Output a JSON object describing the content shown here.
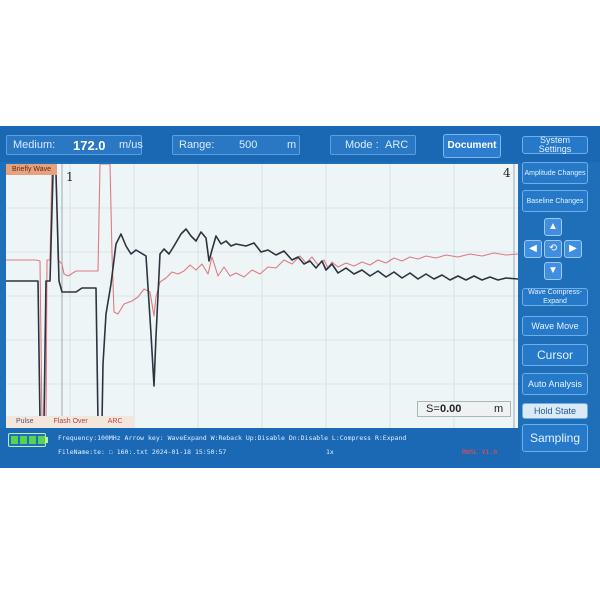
{
  "header": {
    "medium_label": "Medium:",
    "medium_value": "172.0",
    "medium_unit": "m/us",
    "range_label": "Range:",
    "range_value": "500",
    "range_unit": "m",
    "mode_label": "Mode :",
    "mode_value": "ARC",
    "document_button": "Document"
  },
  "sidebar": {
    "system_settings": "System Settings",
    "amplitude_changes": "Amplitude Changes",
    "baseline_changes": "Baseline Changes",
    "wave_compress_expand": "Wave Compress-Expand",
    "wave_move": "Wave Move",
    "cursor": "Cursor",
    "auto_analysis": "Auto Analysis",
    "hold_state": "Hold State",
    "sampling": "Sampling"
  },
  "plot": {
    "wave_tag": "Briefly Wave",
    "cursor_left_label": "1",
    "cursor_right_label": "4",
    "distance_label": "S=",
    "distance_value": "0.00",
    "distance_unit": "m",
    "mode_tabs": [
      "Pulse",
      "Flash Over",
      "ARC"
    ],
    "colors": {
      "dark_trace": "#2c3440",
      "red_trace": "#e07a80",
      "grid": "#c7d6da",
      "cursor": "#8a96a0"
    }
  },
  "chart_data": {
    "type": "line",
    "series": [
      {
        "name": "",
        "color": "#2c3440",
        "points": [
          [
            0,
            117
          ],
          [
            30,
            117
          ],
          [
            32,
            117
          ],
          [
            34,
            257
          ],
          [
            38,
            257
          ],
          [
            40,
            117
          ],
          [
            44,
            117
          ],
          [
            47,
            10
          ],
          [
            50,
            10
          ],
          [
            53,
            117
          ],
          [
            56,
            128
          ],
          [
            70,
            128
          ],
          [
            76,
            124
          ],
          [
            90,
            124
          ],
          [
            92,
            258
          ],
          [
            96,
            258
          ],
          [
            97,
            200
          ],
          [
            100,
            150
          ],
          [
            105,
            120
          ],
          [
            110,
            80
          ],
          [
            115,
            70
          ],
          [
            120,
            82
          ],
          [
            125,
            90
          ],
          [
            130,
            86
          ],
          [
            140,
            92
          ],
          [
            145,
            170
          ],
          [
            148,
            222
          ],
          [
            150,
            172
          ],
          [
            154,
            90
          ],
          [
            158,
            85
          ],
          [
            163,
            90
          ],
          [
            168,
            82
          ],
          [
            175,
            70
          ],
          [
            180,
            65
          ],
          [
            185,
            72
          ],
          [
            190,
            77
          ],
          [
            195,
            68
          ],
          [
            200,
            74
          ],
          [
            203,
            97
          ],
          [
            206,
            86
          ],
          [
            210,
            72
          ],
          [
            215,
            80
          ],
          [
            220,
            77
          ],
          [
            225,
            82
          ],
          [
            230,
            80
          ],
          [
            240,
            82
          ],
          [
            248,
            79
          ],
          [
            255,
            88
          ],
          [
            262,
            86
          ],
          [
            270,
            91
          ],
          [
            278,
            87
          ],
          [
            286,
            96
          ],
          [
            292,
            93
          ],
          [
            298,
            100
          ],
          [
            304,
            97
          ],
          [
            310,
            104
          ],
          [
            316,
            97
          ],
          [
            320,
            106
          ],
          [
            326,
            100
          ],
          [
            332,
            109
          ],
          [
            340,
            104
          ],
          [
            348,
            110
          ],
          [
            356,
            106
          ],
          [
            364,
            112
          ],
          [
            372,
            107
          ],
          [
            380,
            113
          ],
          [
            388,
            108
          ],
          [
            396,
            114
          ],
          [
            404,
            109
          ],
          [
            412,
            115
          ],
          [
            420,
            110
          ],
          [
            428,
            115
          ],
          [
            436,
            111
          ],
          [
            444,
            116
          ],
          [
            452,
            112
          ],
          [
            460,
            116
          ],
          [
            468,
            112
          ],
          [
            476,
            116
          ],
          [
            484,
            113
          ],
          [
            492,
            116
          ],
          [
            500,
            114
          ],
          [
            512,
            115
          ]
        ]
      },
      {
        "name": "",
        "color": "#e07a80",
        "points": [
          [
            0,
            96
          ],
          [
            30,
            96
          ],
          [
            34,
            97
          ],
          [
            36,
            258
          ],
          [
            40,
            258
          ],
          [
            41,
            96
          ],
          [
            44,
            96
          ],
          [
            46,
            0
          ],
          [
            50,
            0
          ],
          [
            52,
            96
          ],
          [
            56,
            100
          ],
          [
            58,
            110
          ],
          [
            62,
            112
          ],
          [
            70,
            107
          ],
          [
            80,
            107
          ],
          [
            92,
            107
          ],
          [
            94,
            0
          ],
          [
            104,
            0
          ],
          [
            106,
            90
          ],
          [
            108,
            148
          ],
          [
            112,
            150
          ],
          [
            118,
            140
          ],
          [
            126,
            137
          ],
          [
            132,
            133
          ],
          [
            138,
            125
          ],
          [
            144,
            128
          ],
          [
            148,
            152
          ],
          [
            150,
            133
          ],
          [
            154,
            118
          ],
          [
            160,
            114
          ],
          [
            166,
            108
          ],
          [
            172,
            110
          ],
          [
            178,
            107
          ],
          [
            184,
            101
          ],
          [
            190,
            106
          ],
          [
            196,
            100
          ],
          [
            202,
            110
          ],
          [
            206,
            93
          ],
          [
            212,
            112
          ],
          [
            218,
            103
          ],
          [
            224,
            112
          ],
          [
            230,
            109
          ],
          [
            238,
            113
          ],
          [
            246,
            106
          ],
          [
            254,
            110
          ],
          [
            262,
            103
          ],
          [
            270,
            104
          ],
          [
            278,
            96
          ],
          [
            286,
            100
          ],
          [
            294,
            92
          ],
          [
            300,
            99
          ],
          [
            306,
            93
          ],
          [
            312,
            101
          ],
          [
            318,
            96
          ],
          [
            322,
            104
          ],
          [
            326,
            98
          ],
          [
            332,
            103
          ],
          [
            340,
            99
          ],
          [
            348,
            102
          ],
          [
            356,
            98
          ],
          [
            364,
            101
          ],
          [
            372,
            96
          ],
          [
            380,
            99
          ],
          [
            388,
            94
          ],
          [
            396,
            97
          ],
          [
            404,
            93
          ],
          [
            412,
            95
          ],
          [
            420,
            92
          ],
          [
            430,
            94
          ],
          [
            440,
            91
          ],
          [
            452,
            93
          ],
          [
            464,
            90
          ],
          [
            476,
            92
          ],
          [
            488,
            89
          ],
          [
            500,
            91
          ],
          [
            512,
            90
          ]
        ]
      }
    ],
    "xlim": [
      0,
      512
    ],
    "ylim": [
      264,
      0
    ],
    "grid": true
  },
  "status": {
    "line1": "Frequency:100MHz  Arrow key:  WaveExpand  W:Reback   Up:Disable  Dn:Disable  L:Compress  R:Expand",
    "line2": "FileName:te:  ☐ 160:.txt   2024-01-18 15:50:57",
    "line2_right": "1x",
    "version": "RWSL V1.0"
  }
}
